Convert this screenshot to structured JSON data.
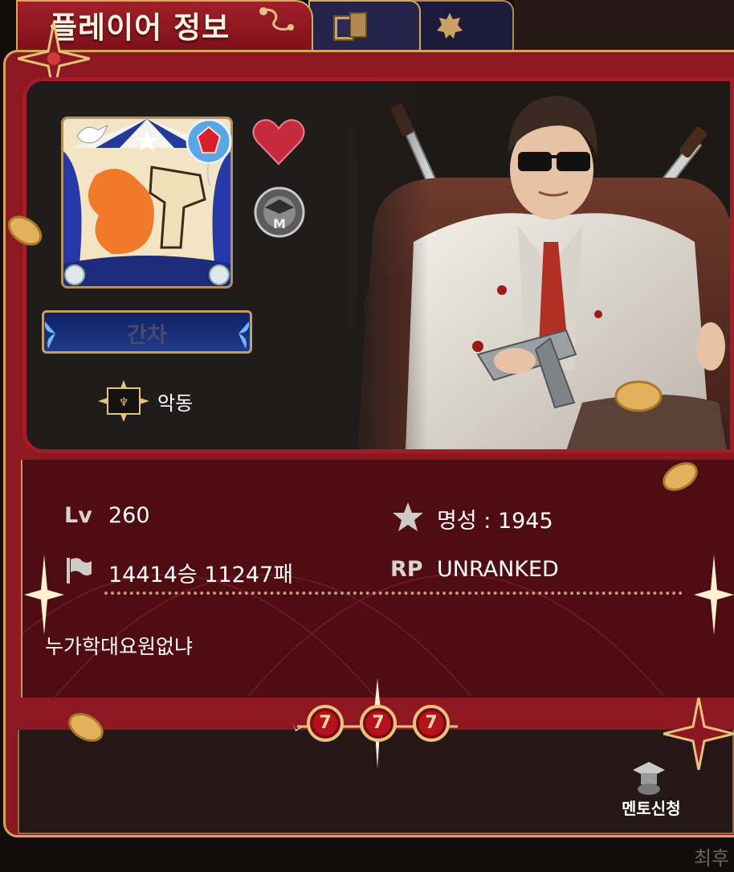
{
  "header": {
    "title": "플레이어 정보",
    "tabs": [
      {
        "icon": "cards-icon"
      },
      {
        "icon": "badge-icon"
      }
    ]
  },
  "profile": {
    "nickname": "간차",
    "title_name": "악동",
    "icons": [
      "heart-icon",
      "mentor-medal-icon"
    ]
  },
  "stats": {
    "level_label": "Lv",
    "level_value": "260",
    "fame_label": "명성 : 1945",
    "record_value": "14414승 11247패",
    "rp_label": "RP",
    "rp_value": "UNRANKED"
  },
  "bio": "누가학대요원없냐",
  "jackpot": [
    "7",
    "7",
    "7"
  ],
  "mentor": {
    "label": "멘토신청"
  },
  "corner_text": "최후",
  "colors": {
    "frame": "#8e1821",
    "gold": "#d5a45d",
    "panel": "#4f0c12"
  }
}
